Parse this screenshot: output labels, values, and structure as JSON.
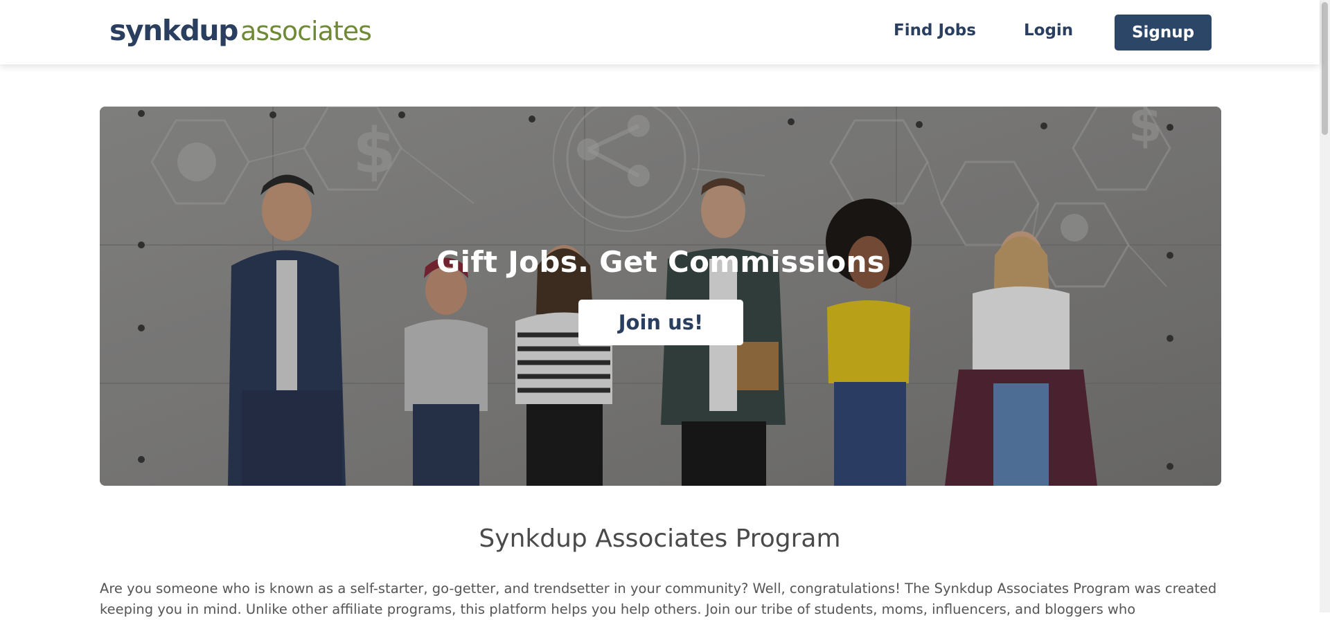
{
  "header": {
    "logo_primary": "synkdup",
    "logo_secondary": "associates",
    "nav": {
      "find_jobs": "Find Jobs",
      "login": "Login",
      "signup": "Signup"
    }
  },
  "hero": {
    "title": "Gift Jobs. Get Commissions",
    "cta": "Join us!"
  },
  "program": {
    "title": "Synkdup Associates Program",
    "body": "Are you someone who is known as a self-starter, go-getter, and trendsetter in your community? Well, congratulations! The Synkdup Associates Program was created keeping you in mind. Unlike other affiliate programs, this platform helps you help others. Join our tribe of students, moms, influencers, and bloggers who"
  },
  "colors": {
    "brand_navy": "#2c4668",
    "brand_green": "#6f8a35",
    "text_dark": "#2a3f5f"
  }
}
